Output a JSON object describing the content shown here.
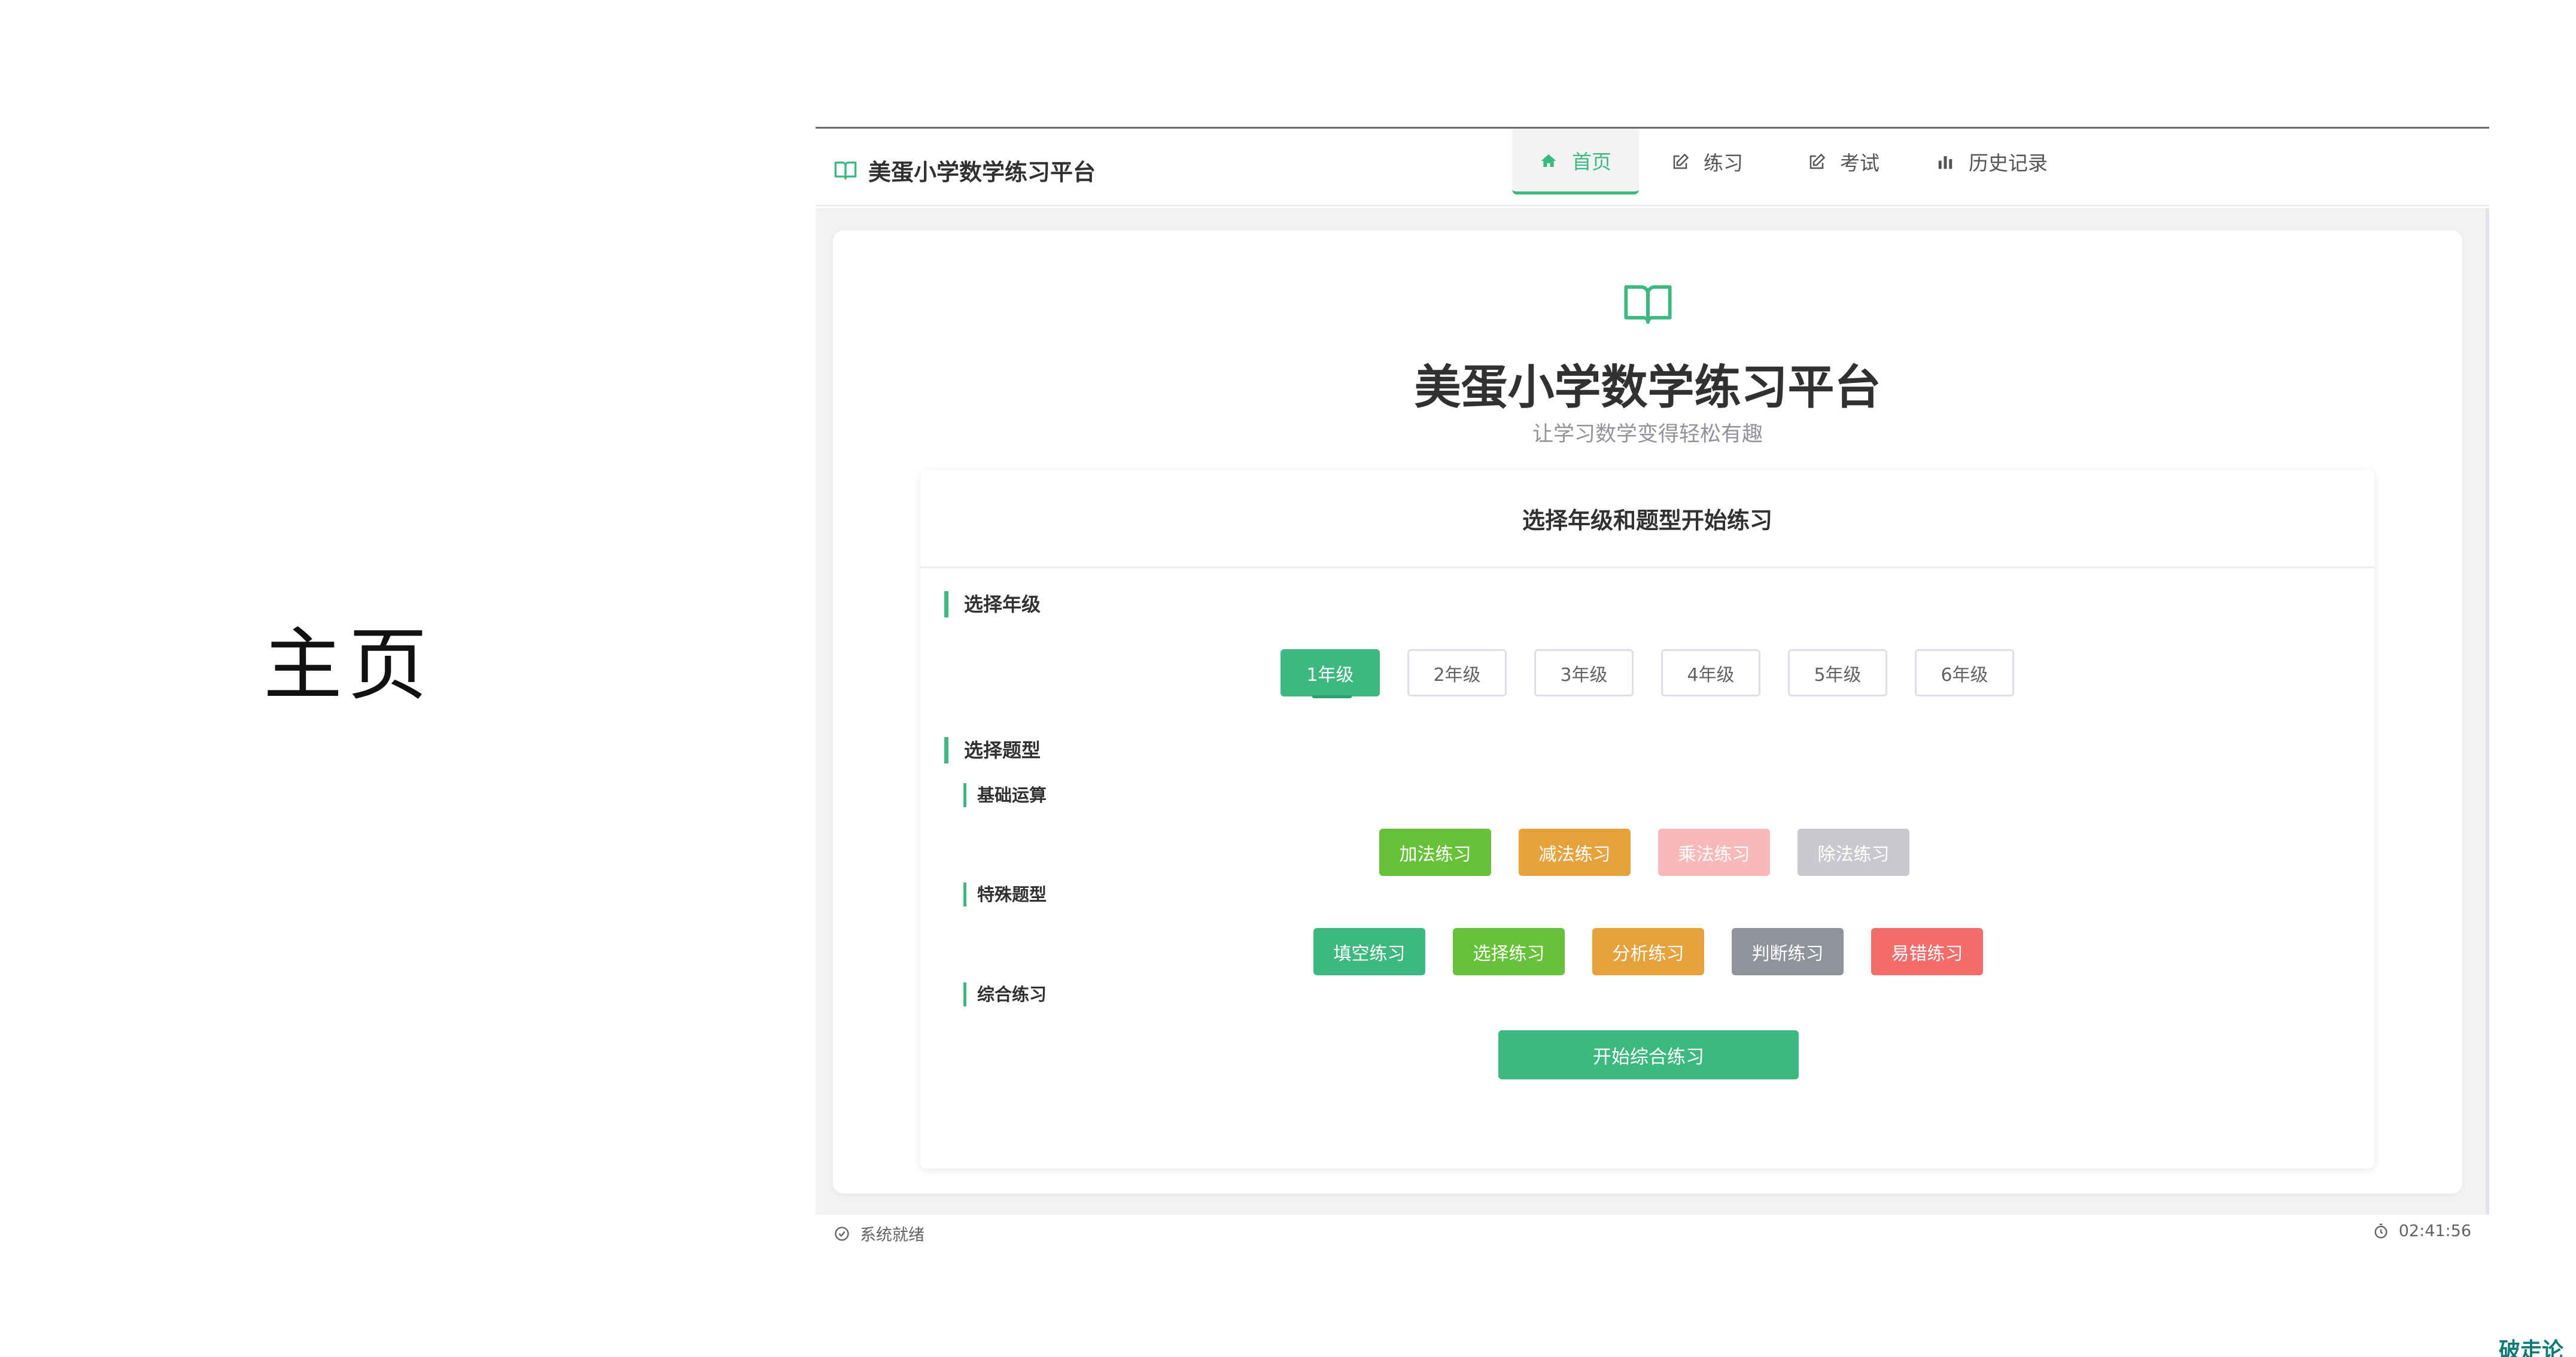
{
  "page_label": "主页",
  "watermark": "破走论坛",
  "colors": {
    "primary": "#3eb881",
    "addition": "#67c23a",
    "subtraction": "#e6a23c",
    "multiplication": "#f7b9b9",
    "division": "#c8c9cc",
    "fill_blank": "#3eb881",
    "choice": "#67c23a",
    "analysis": "#e6a23c",
    "judge": "#909399",
    "mistakes": "#f56c6c"
  },
  "navbar": {
    "brand_icon": "book-open-icon",
    "brand_title": "美蛋小学数学练习平台",
    "tabs": [
      {
        "label": "首页",
        "icon": "home-icon",
        "active": true
      },
      {
        "label": "练习",
        "icon": "edit-icon",
        "active": false
      },
      {
        "label": "考试",
        "icon": "edit-icon",
        "active": false
      },
      {
        "label": "历史记录",
        "icon": "bar-chart-icon",
        "active": false
      }
    ]
  },
  "hero": {
    "icon": "book-open-icon",
    "title": "美蛋小学数学练习平台",
    "subtitle": "让学习数学变得轻松有趣"
  },
  "selection": {
    "header": "选择年级和题型开始练习",
    "grade_label": "选择年级",
    "grades": [
      "1年级",
      "2年级",
      "3年级",
      "4年级",
      "5年级",
      "6年级"
    ],
    "selected_grade": "1年级",
    "type_label": "选择题型",
    "basic": {
      "label": "基础运算",
      "buttons": [
        "加法练习",
        "减法练习",
        "乘法练习",
        "除法练习"
      ]
    },
    "special": {
      "label": "特殊题型",
      "buttons": [
        "填空练习",
        "选择练习",
        "分析练习",
        "判断练习",
        "易错练习"
      ]
    },
    "comprehensive": {
      "label": "综合练习",
      "button": "开始综合练习"
    }
  },
  "statusbar": {
    "status_icon": "check-circle-icon",
    "status": "系统就绪",
    "clock_icon": "timer-icon",
    "time": "02:41:56"
  }
}
